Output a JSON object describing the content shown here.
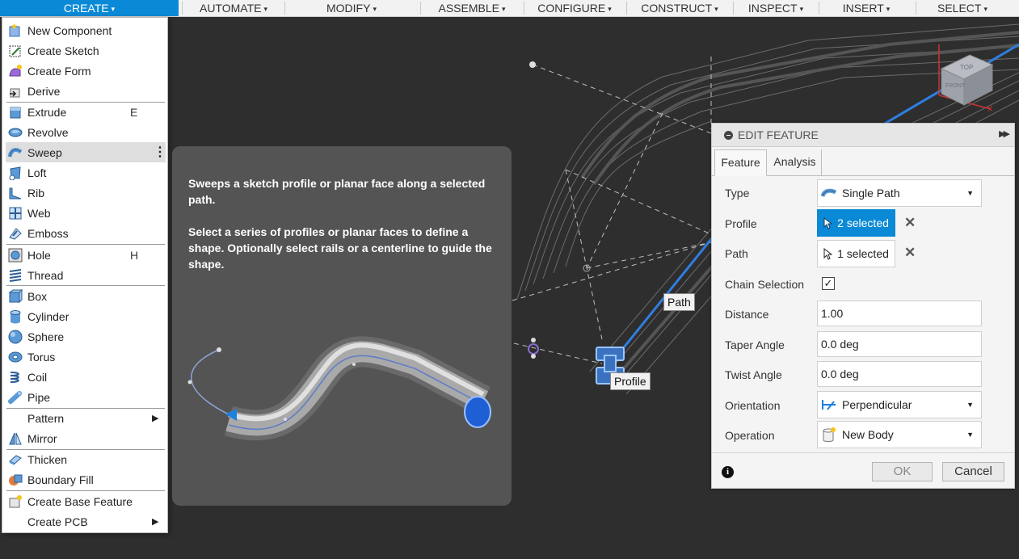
{
  "toolbar": {
    "items": [
      {
        "label": "CREATE"
      },
      {
        "label": "AUTOMATE"
      },
      {
        "label": "MODIFY"
      },
      {
        "label": "ASSEMBLE"
      },
      {
        "label": "CONFIGURE"
      },
      {
        "label": "CONSTRUCT"
      },
      {
        "label": "INSPECT"
      },
      {
        "label": "INSERT"
      },
      {
        "label": "SELECT"
      }
    ],
    "caret": "▾"
  },
  "create_menu": {
    "items": [
      {
        "label": "New Component",
        "icon": "new-component-icon"
      },
      {
        "label": "Create Sketch",
        "icon": "create-sketch-icon"
      },
      {
        "label": "Create Form",
        "icon": "create-form-icon"
      },
      {
        "label": "Derive",
        "icon": "derive-icon"
      },
      {
        "label": "Extrude",
        "icon": "extrude-icon",
        "shortcut": "E"
      },
      {
        "label": "Revolve",
        "icon": "revolve-icon"
      },
      {
        "label": "Sweep",
        "icon": "sweep-icon",
        "highlighted": true
      },
      {
        "label": "Loft",
        "icon": "loft-icon"
      },
      {
        "label": "Rib",
        "icon": "rib-icon"
      },
      {
        "label": "Web",
        "icon": "web-icon"
      },
      {
        "label": "Emboss",
        "icon": "emboss-icon"
      },
      {
        "label": "Hole",
        "icon": "hole-icon",
        "shortcut": "H"
      },
      {
        "label": "Thread",
        "icon": "thread-icon"
      },
      {
        "label": "Box",
        "icon": "box-icon"
      },
      {
        "label": "Cylinder",
        "icon": "cylinder-icon"
      },
      {
        "label": "Sphere",
        "icon": "sphere-icon"
      },
      {
        "label": "Torus",
        "icon": "torus-icon"
      },
      {
        "label": "Coil",
        "icon": "coil-icon"
      },
      {
        "label": "Pipe",
        "icon": "pipe-icon"
      },
      {
        "label": "Pattern",
        "icon": "",
        "submenu": true
      },
      {
        "label": "Mirror",
        "icon": "mirror-icon"
      },
      {
        "label": "Thicken",
        "icon": "thicken-icon"
      },
      {
        "label": "Boundary Fill",
        "icon": "boundary-fill-icon"
      },
      {
        "label": "Create Base Feature",
        "icon": "create-base-feature-icon"
      },
      {
        "label": "Create PCB",
        "icon": "",
        "submenu": true
      }
    ],
    "more_glyph": "⋮",
    "submenu_glyph": "▶"
  },
  "tooltip": {
    "line1": "Sweeps a sketch profile or planar face along a selected path.",
    "line2": "Select a series of profiles or planar faces to define a shape. Optionally select rails or a centerline to guide the shape."
  },
  "edit_feature": {
    "title": "EDIT FEATURE",
    "expand_glyph": "▶▶",
    "tabs": [
      {
        "label": "Feature",
        "active": true
      },
      {
        "label": "Analysis",
        "active": false
      }
    ],
    "rows": {
      "type": {
        "label": "Type",
        "value": "Single Path"
      },
      "profile": {
        "label": "Profile",
        "value": "2 selected"
      },
      "path": {
        "label": "Path",
        "value": "1 selected"
      },
      "chain": {
        "label": "Chain Selection",
        "checked": true,
        "mark": "✓"
      },
      "distance": {
        "label": "Distance",
        "value": "1.00"
      },
      "taper": {
        "label": "Taper Angle",
        "value": "0.0 deg"
      },
      "twist": {
        "label": "Twist Angle",
        "value": "0.0 deg"
      },
      "orientation": {
        "label": "Orientation",
        "value": "Perpendicular"
      },
      "operation": {
        "label": "Operation",
        "value": "New Body"
      }
    },
    "clear_glyph": "✕",
    "info_glyph": "i",
    "ok_label": "OK",
    "cancel_label": "Cancel"
  },
  "viewport": {
    "path_label": "Path",
    "profile_label": "Profile",
    "viewcube_top": "TOP",
    "viewcube_front": "FRONT",
    "axis_x": "X"
  },
  "colors": {
    "accent": "#0a8ad6",
    "menu_highlight": "#dedede",
    "tooltip_bg": "#545454",
    "viewport_bg": "#2e2e2f",
    "path_blue": "#2f7fe0"
  }
}
